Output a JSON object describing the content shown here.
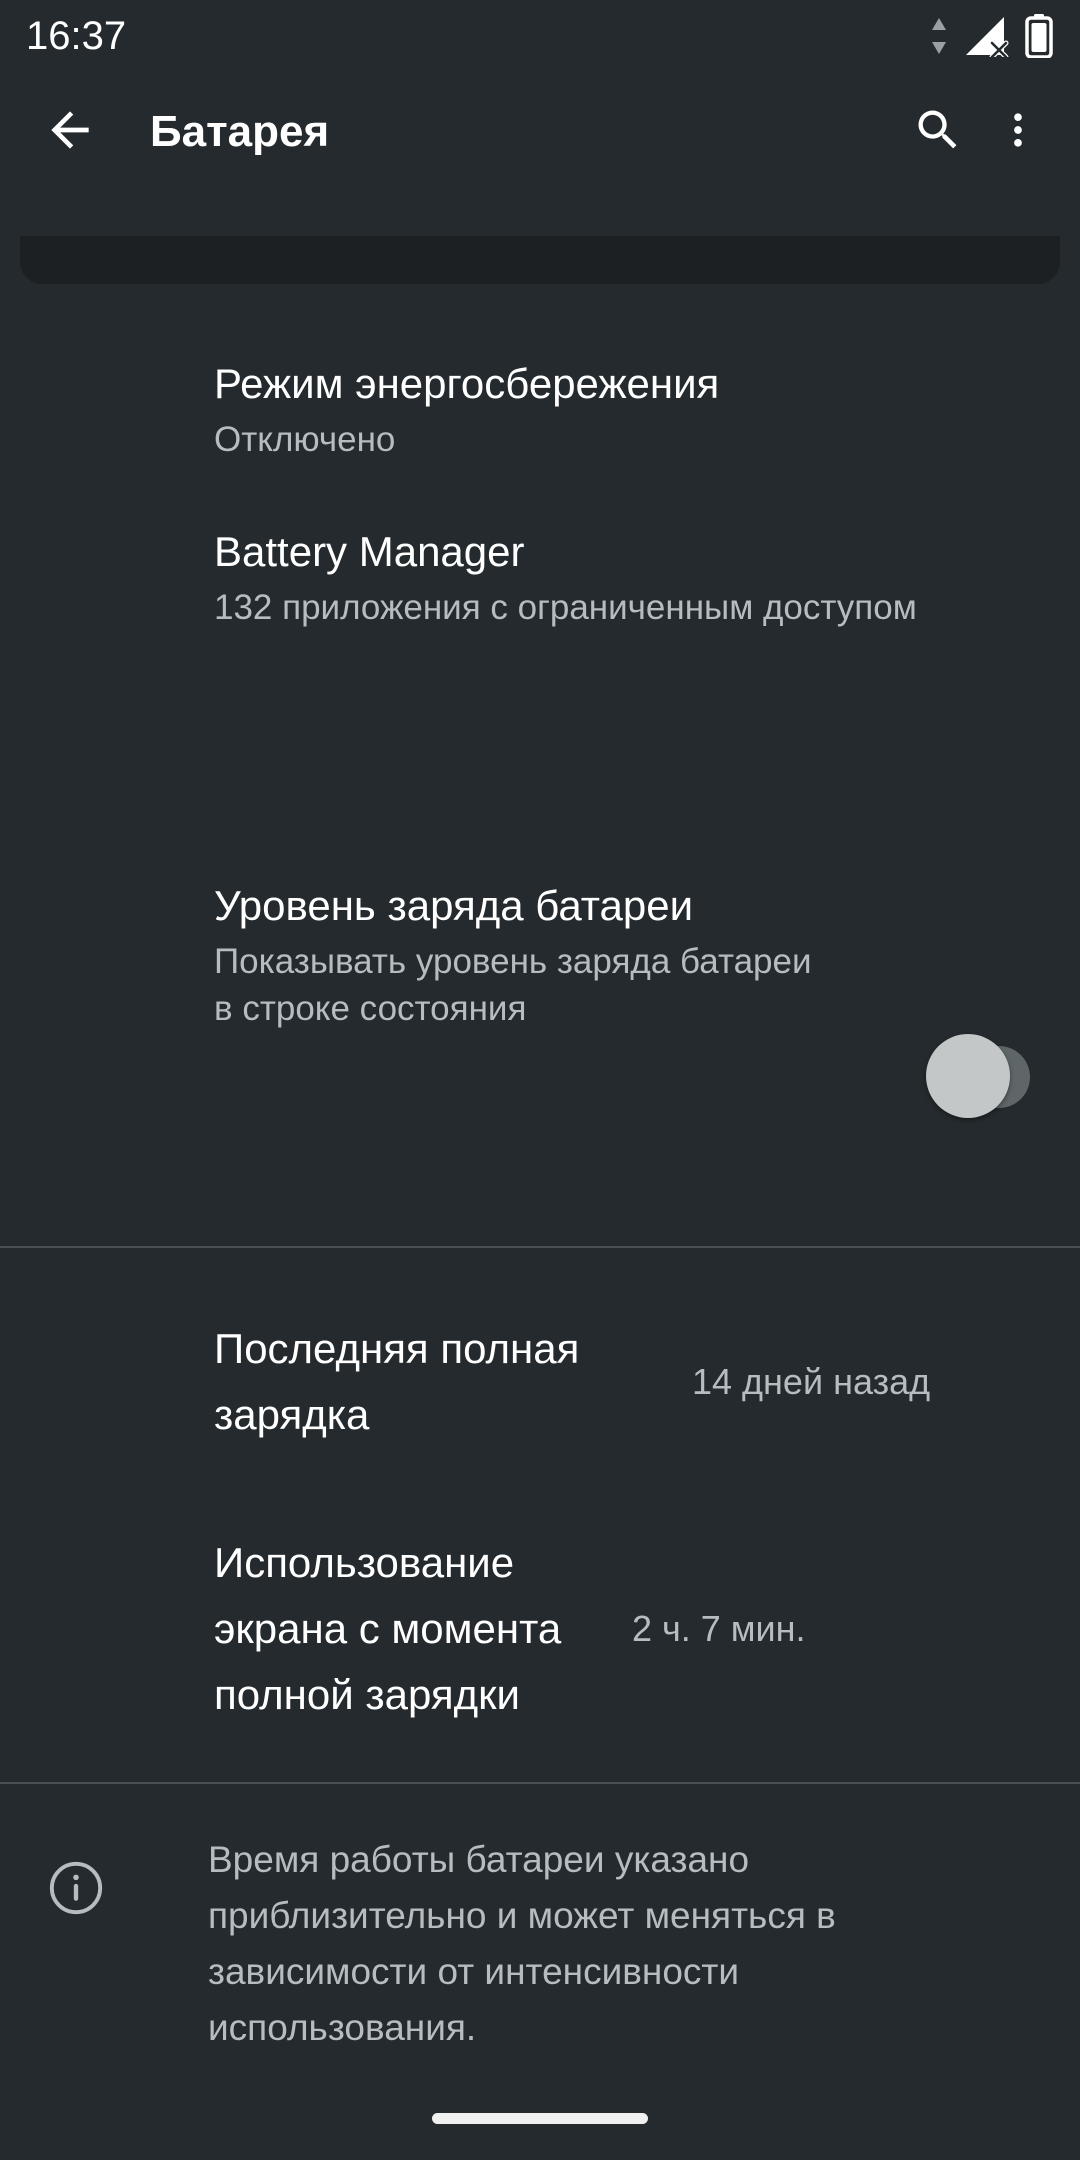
{
  "status_bar": {
    "time": "16:37",
    "icons": [
      "data-transfer-icon",
      "signal-off-icon",
      "battery-icon"
    ]
  },
  "app_bar": {
    "back_label": "Назад",
    "title": "Батарея",
    "search_label": "Поиск",
    "overflow_label": "Ещё"
  },
  "colors": {
    "background": "#242a2d",
    "partial_card": "#1c2022",
    "primary_text": "#ffffff",
    "secondary_text": "#b6bcbf",
    "divider": "#4a5154",
    "switch_track_off": "#5f6668",
    "switch_thumb_off": "#c3c7c8",
    "nav_pill": "#f1f1f1"
  },
  "sections": [
    {
      "id": "battery-settings",
      "items": [
        {
          "name": "power-save-mode",
          "title": "Режим энергосбережения",
          "summary": "Отключено",
          "control": "none"
        },
        {
          "name": "battery-manager",
          "title": "Battery Manager",
          "summary": "132 приложения с ограниченным доступом",
          "control": "none"
        },
        {
          "name": "battery-level-percent",
          "title": "Уровень заряда батареи",
          "summary": "Показывать уровень заряда батареи в строке состояния",
          "control": "switch",
          "switch_state": "off"
        }
      ]
    },
    {
      "id": "battery-stats",
      "items": [
        {
          "name": "last-full-charge",
          "title": "Последняя полная зарядка",
          "value": "14 дней назад"
        },
        {
          "name": "screen-usage-since-full-charge",
          "title": "Использование экрана с момента полной зарядки",
          "value": "2 ч. 7 мин."
        }
      ]
    }
  ],
  "footer": {
    "icon": "info-circle-icon",
    "text": "Время работы батареи указано приблизительно и может меняться в зависимости от интенсивности использования."
  }
}
